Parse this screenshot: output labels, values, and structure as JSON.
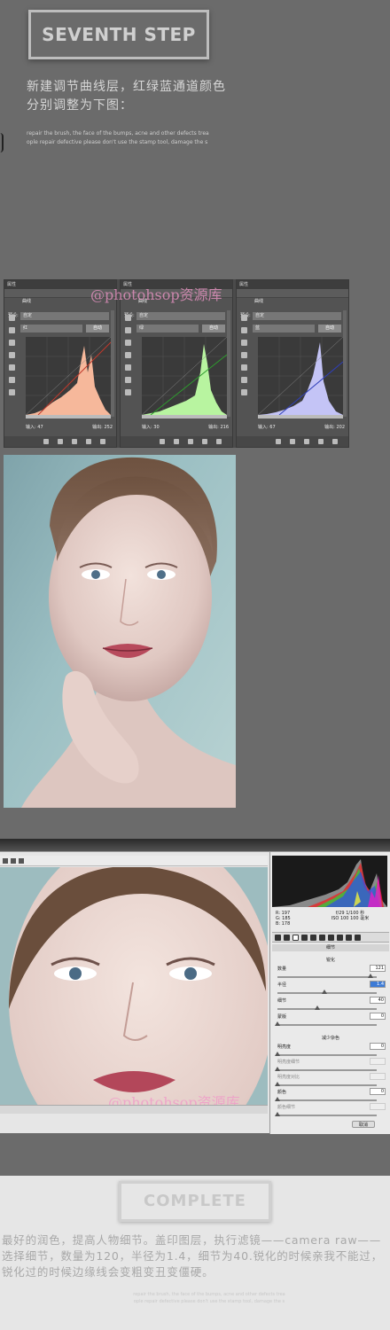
{
  "header": {
    "step_title": "SEVENTH STEP",
    "cn_line1": "新建调节曲线层，红绿蓝通道颜色",
    "cn_line2": "分别调整为下图：",
    "en_line1": "repair the brush, the face of the bumps, acne and other defects trea",
    "en_line2": "ople repair defective please don't use the stamp tool, damage the s"
  },
  "curves": {
    "watermark": "@photohsop资源库",
    "panels": [
      {
        "title": "属性",
        "name": "曲线",
        "preset_label": "预设:",
        "preset_value": "自定",
        "channel": "红",
        "auto_label": "自动",
        "input_label": "输入:",
        "input_value": "47",
        "output_label": "输出:",
        "output_value": "252",
        "color": "#f6b89b",
        "line_color": "#c0392b"
      },
      {
        "title": "属性",
        "name": "曲线",
        "preset_label": "预设:",
        "preset_value": "自定",
        "channel": "绿",
        "auto_label": "自动",
        "input_label": "输入:",
        "input_value": "30",
        "output_label": "输出:",
        "output_value": "216",
        "color": "#b8f4a0",
        "line_color": "#2e9b2e"
      },
      {
        "title": "属性",
        "name": "曲线",
        "preset_label": "预设:",
        "preset_value": "自定",
        "channel": "蓝",
        "auto_label": "自动",
        "input_label": "输入:",
        "input_value": "67",
        "output_label": "输出:",
        "output_value": "202",
        "color": "#c4c4f6",
        "line_color": "#2f3fb8"
      }
    ]
  },
  "camera_raw": {
    "watermark": "@photohsop资源库",
    "rgb": {
      "r": "R:  197",
      "g": "G:  185",
      "b": "B:  178"
    },
    "camera_info_1": "f/29   1/100 秒",
    "camera_info_2": "ISO 100    100 毫米",
    "panel_title": "细节",
    "sharpen_title": "锐化",
    "sliders": [
      {
        "label": "数量",
        "value": "121",
        "selected": false
      },
      {
        "label": "半径",
        "value": "1.4",
        "selected": true
      },
      {
        "label": "细节",
        "value": "40",
        "selected": false
      },
      {
        "label": "蒙版",
        "value": "0",
        "selected": false
      }
    ],
    "noise_title": "减少杂色",
    "noise_sliders": [
      {
        "label": "明亮度",
        "value": "0",
        "dim": false
      },
      {
        "label": "明亮度细节",
        "value": "",
        "dim": true
      },
      {
        "label": "明亮度对比",
        "value": "",
        "dim": true
      },
      {
        "label": "颜色",
        "value": "0",
        "dim": false
      },
      {
        "label": "颜色细节",
        "value": "",
        "dim": true
      }
    ],
    "cancel_label": "取消"
  },
  "complete": {
    "title": "COMPLETE",
    "text": "最好的润色，提高人物细节。盖印图层，执行滤镜——camera raw——选择细节，数量为120，半径为1.4，细节为40.锐化的时候亲我不能过，锐化过的时候边缘线会变粗变丑变僵硬。",
    "en_line1": "repair the brush, the face of the bumps, acne and other defects trea",
    "en_line2": "ople repair defective please don't use the stamp tool, damage the s"
  }
}
